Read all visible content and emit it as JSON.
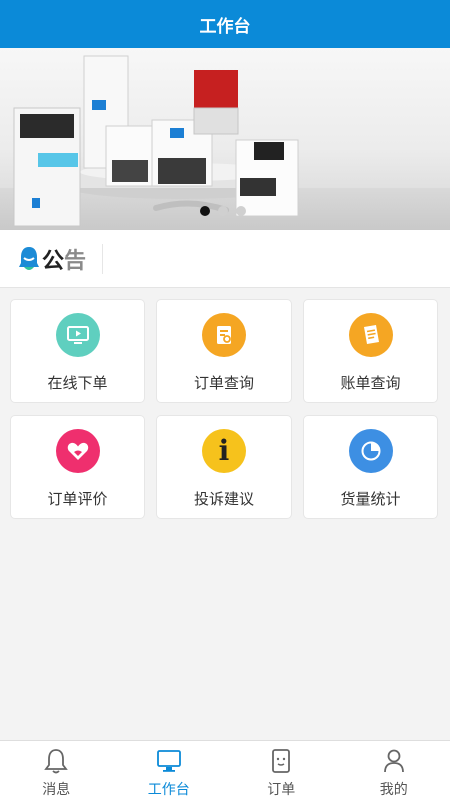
{
  "header": {
    "title": "工作台"
  },
  "banner": {
    "slide_count": 3,
    "active_slide": 1
  },
  "notice": {
    "title_part1": "公",
    "title_part2": "告"
  },
  "menu": [
    {
      "label": "在线下单",
      "icon": "monitor-play-icon",
      "color": "#5fcfbf"
    },
    {
      "label": "订单查询",
      "icon": "document-search-icon",
      "color": "#f5a623"
    },
    {
      "label": "账单查询",
      "icon": "bill-icon",
      "color": "#f5a623"
    },
    {
      "label": "订单评价",
      "icon": "heart-icon",
      "color": "#ef2f6e"
    },
    {
      "label": "投诉建议",
      "icon": "info-icon",
      "color": "#f6c21c"
    },
    {
      "label": "货量统计",
      "icon": "pie-chart-icon",
      "color": "#3d8fe3"
    }
  ],
  "tabbar": {
    "active": 1,
    "items": [
      {
        "label": "消息",
        "icon": "bell-icon"
      },
      {
        "label": "工作台",
        "icon": "desktop-icon"
      },
      {
        "label": "订单",
        "icon": "order-icon"
      },
      {
        "label": "我的",
        "icon": "user-icon"
      }
    ]
  },
  "colors": {
    "primary": "#0b8ad8",
    "background": "#f3f3f3"
  }
}
